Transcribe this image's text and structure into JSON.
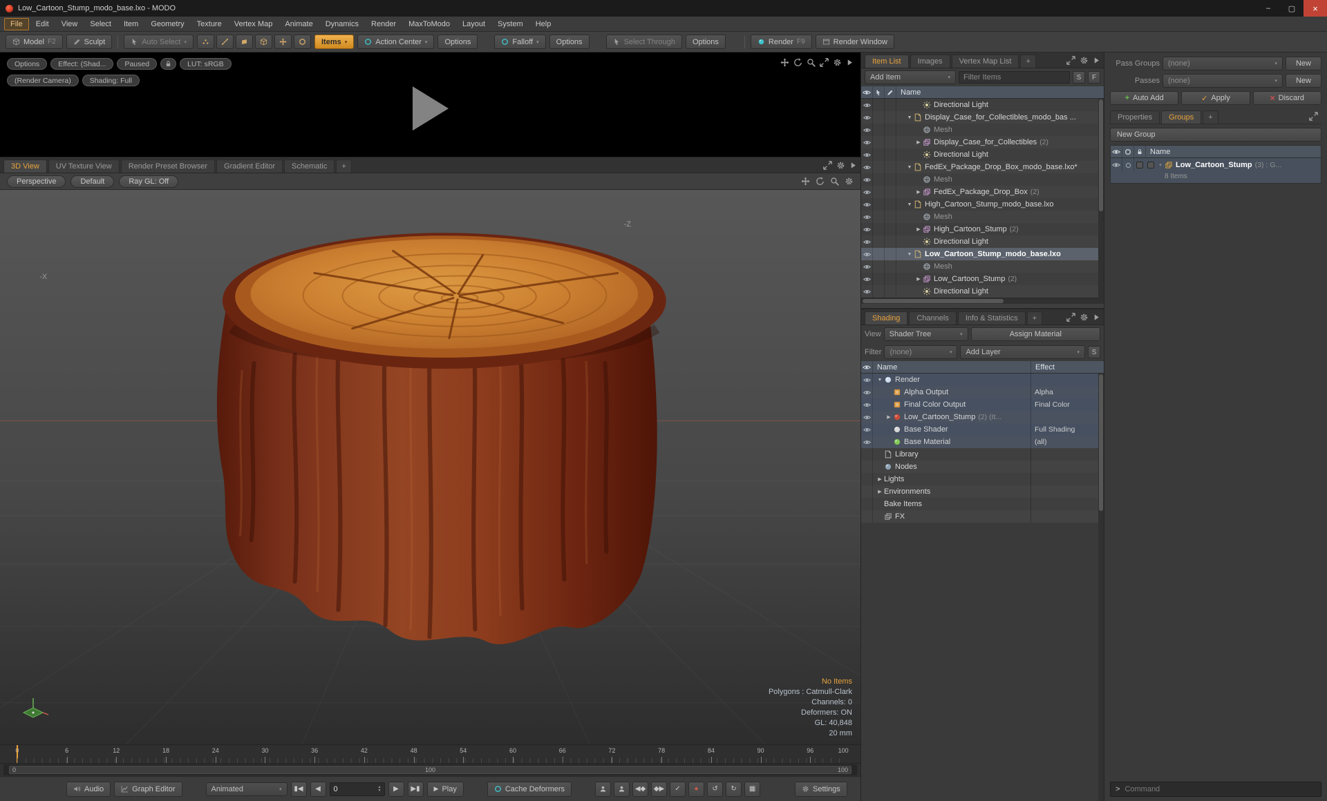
{
  "window": {
    "title": "Low_Cartoon_Stump_modo_base.lxo - MODO",
    "minimize_glyph": "–",
    "maximize_glyph": "▢",
    "close_glyph": "×"
  },
  "menubar": {
    "items": [
      "File",
      "Edit",
      "View",
      "Select",
      "Item",
      "Geometry",
      "Texture",
      "Vertex Map",
      "Animate",
      "Dynamics",
      "Render",
      "MaxToModo",
      "Layout",
      "System",
      "Help"
    ],
    "active": "File"
  },
  "toolbar": {
    "model_label": "Model",
    "model_shortcut": "F2",
    "sculpt_label": "Sculpt",
    "auto_select_label": "Auto Select",
    "mode_icons": [
      "vertices-mode",
      "edges-mode",
      "polygons-mode",
      "items-mode",
      "center-mode",
      "pivot-mode"
    ],
    "items_label": "Items",
    "action_center_label": "Action Center",
    "action_options_label": "Options",
    "falloff_label": "Falloff",
    "falloff_options_label": "Options",
    "select_through_label": "Select Through",
    "select_options_label": "Options",
    "render_label": "Render",
    "render_shortcut": "F9",
    "render_window_label": "Render Window"
  },
  "preview": {
    "options_label": "Options",
    "effect_label": "Effect: (Shad...",
    "paused_label": "Paused",
    "lut_label": "LUT: sRGB",
    "camera_label": "(Render Camera)",
    "shading_label": "Shading: Full"
  },
  "viewport": {
    "tabs": [
      "3D View",
      "UV Texture View",
      "Render Preset Browser",
      "Gradient Editor",
      "Schematic"
    ],
    "active_tab": "3D View",
    "add_tab_label": "+",
    "perspective_label": "Perspective",
    "default_label": "Default",
    "raygl_label": "Ray GL: Off",
    "axis_labels": {
      "z": "-Z",
      "x": "-X"
    },
    "stats": {
      "no_items": "No Items",
      "polygons": "Polygons : Catmull-Clark",
      "channels": "Channels: 0",
      "deformers": "Deformers: ON",
      "gl": "GL: 40,848",
      "scale": "20 mm"
    }
  },
  "timeline": {
    "major_ticks": [
      0,
      6,
      12,
      18,
      24,
      30,
      36,
      42,
      48,
      54,
      60,
      66,
      72,
      78,
      84,
      90,
      96
    ],
    "end_tick": "100",
    "current_frame": 0,
    "range_start_label": "0",
    "range_center_label": "100",
    "range_end_label": "100"
  },
  "transport": {
    "audio_label": "Audio",
    "graph_editor_label": "Graph Editor",
    "mode_value": "Animated",
    "frame_value": "0",
    "jump_start_glyph": "▮◀",
    "prev_frame_glyph": "◀",
    "next_frame_glyph": "▶",
    "jump_end_glyph": "▶▮",
    "play_glyph": "▶",
    "play_label": "Play",
    "cache_deformers_label": "Cache Deformers",
    "icon_buttons": [
      {
        "name": "key-actor",
        "icon": "user"
      },
      {
        "name": "key-channel",
        "icon": "user"
      },
      {
        "name": "prev-keyframe",
        "glyph": "◀◆"
      },
      {
        "name": "next-keyframe",
        "glyph": "◆▶"
      },
      {
        "name": "auto-key",
        "glyph": "✓"
      },
      {
        "name": "record",
        "glyph": "●",
        "color": "#cc5a4a"
      },
      {
        "name": "loop-back",
        "glyph": "↺"
      },
      {
        "name": "loop-forward",
        "glyph": "↻"
      },
      {
        "name": "step-options",
        "glyph": "▦"
      }
    ],
    "settings_label": "Settings"
  },
  "item_list": {
    "tabs": [
      "Item List",
      "Images",
      "Vertex Map List"
    ],
    "active_tab": "Item List",
    "add_tab_label": "+",
    "add_item_label": "Add Item",
    "filter_placeholder": "Filter Items",
    "sort_label": "S",
    "filter_btn_label": "F",
    "name_header": "Name",
    "rows": [
      {
        "label": "Directional Light",
        "icon": "directional-light",
        "indent": 2,
        "eye": true
      },
      {
        "label": "Display_Case_for_Collectibles_modo_bas ...",
        "icon": "scene-file",
        "indent": 1,
        "expander": "open",
        "eye": true
      },
      {
        "label": "Mesh",
        "icon": "mesh",
        "indent": 2,
        "dim": true,
        "eye": true
      },
      {
        "label": "Display_Case_for_Collectibles",
        "suffix": "(2)",
        "icon": "mesh-group",
        "indent": 2,
        "expander": "closed",
        "eye": true
      },
      {
        "label": "Directional Light",
        "icon": "directional-light",
        "indent": 2,
        "eye": true
      },
      {
        "label": "FedEx_Package_Drop_Box_modo_base.lxo*",
        "icon": "scene-file",
        "indent": 1,
        "expander": "open",
        "eye": true
      },
      {
        "label": "Mesh",
        "icon": "mesh",
        "indent": 2,
        "dim": true,
        "eye": true
      },
      {
        "label": "FedEx_Package_Drop_Box",
        "suffix": "(2)",
        "icon": "mesh-group",
        "indent": 2,
        "expander": "closed",
        "eye": true
      },
      {
        "label": "High_Cartoon_Stump_modo_base.lxo",
        "icon": "scene-file",
        "indent": 1,
        "expander": "open",
        "eye": true
      },
      {
        "label": "Mesh",
        "icon": "mesh",
        "indent": 2,
        "dim": true,
        "eye": true
      },
      {
        "label": "High_Cartoon_Stump",
        "suffix": "(2)",
        "icon": "mesh-group",
        "indent": 2,
        "expander": "closed",
        "eye": true
      },
      {
        "label": "Directional Light",
        "icon": "directional-light",
        "indent": 2,
        "eye": true
      },
      {
        "label": "Low_Cartoon_Stump_modo_base.lxo",
        "icon": "scene-file",
        "indent": 1,
        "expander": "open",
        "selected": true,
        "bold": true,
        "eye": true
      },
      {
        "label": "Mesh",
        "icon": "mesh",
        "indent": 2,
        "dim": true,
        "eye": true
      },
      {
        "label": "Low_Cartoon_Stump",
        "suffix": "(2)",
        "icon": "mesh-group",
        "indent": 2,
        "expander": "closed",
        "eye": true
      },
      {
        "label": "Directional Light",
        "icon": "directional-light",
        "indent": 2,
        "eye": true
      }
    ]
  },
  "shading": {
    "tabs": [
      "Shading",
      "Channels",
      "Info & Statistics"
    ],
    "active_tab": "Shading",
    "add_tab_label": "+",
    "view_label": "View",
    "view_value": "Shader Tree",
    "assign_material_label": "Assign Material",
    "filter_label": "Filter",
    "filter_value": "(none)",
    "add_layer_label": "Add Layer",
    "sort_label": "S",
    "name_header": "Name",
    "effect_header": "Effect",
    "rows": [
      {
        "label": "Render",
        "icon": "render",
        "indent": 0,
        "expander": "open",
        "eye": true,
        "blue": true
      },
      {
        "label": "Alpha Output",
        "icon": "output",
        "indent": 1,
        "effect": "Alpha",
        "dropdown": true,
        "eye": true,
        "blue": true
      },
      {
        "label": "Final Color Output",
        "icon": "output",
        "indent": 1,
        "effect": "Final Color",
        "dropdown": true,
        "eye": true,
        "blue": true
      },
      {
        "label": "Low_Cartoon_Stump",
        "suffix": "(2) (It...",
        "icon": "ball-red",
        "indent": 1,
        "expander": "closed",
        "dropdown": true,
        "eye": true,
        "blue": true
      },
      {
        "label": "Base Shader",
        "icon": "ball-gray",
        "indent": 1,
        "effect": "Full Shading",
        "dropdown": true,
        "eye": true,
        "blue": true
      },
      {
        "label": "Base Material",
        "icon": "ball-green",
        "indent": 1,
        "effect": "(all)",
        "dropdown": true,
        "eye": true,
        "blue": true
      },
      {
        "label": "Library",
        "icon": "library",
        "indent": 0
      },
      {
        "label": "Nodes",
        "icon": "nodes",
        "indent": 0
      },
      {
        "label": "Lights",
        "indent": 0,
        "expander": "closed"
      },
      {
        "label": "Environments",
        "indent": 0,
        "expander": "closed"
      },
      {
        "label": "Bake Items",
        "indent": 0
      },
      {
        "label": "FX",
        "icon": "fx",
        "indent": 0
      }
    ]
  },
  "groups_panel": {
    "pass_groups_label": "Pass Groups",
    "pass_groups_value": "(none)",
    "pass_groups_new_label": "New",
    "passes_label": "Passes",
    "passes_value": "(none)",
    "passes_new_label": "New",
    "auto_add_label": "Auto Add",
    "apply_label": "Apply",
    "discard_label": "Discard",
    "tabs": [
      "Properties",
      "Groups"
    ],
    "active_tab": "Groups",
    "add_tab_label": "+",
    "new_group_label": "New Group",
    "name_header": "Name",
    "group_name": "Low_Cartoon_Stump",
    "group_suffix": "(3) : G...",
    "group_items": "8 Items"
  },
  "command_bar": {
    "prompt": ">",
    "placeholder": "Command"
  },
  "icons": {
    "move-icon": "four-way-arrows",
    "rotate-icon": "circular-arrow",
    "zoom-icon": "magnifier",
    "expand-icon": "diagonal-arrows",
    "gear-icon": "gear",
    "panel-menu-icon": "right-triangle",
    "lock-icon": "padlock",
    "eye-icon": "eye",
    "play-icon": "triangle"
  },
  "colors": {
    "accent_orange": "#e8a33c",
    "selection_blue": "#4b5260",
    "stump_bark": "#7c2c14",
    "stump_top": "#c97a2e"
  }
}
